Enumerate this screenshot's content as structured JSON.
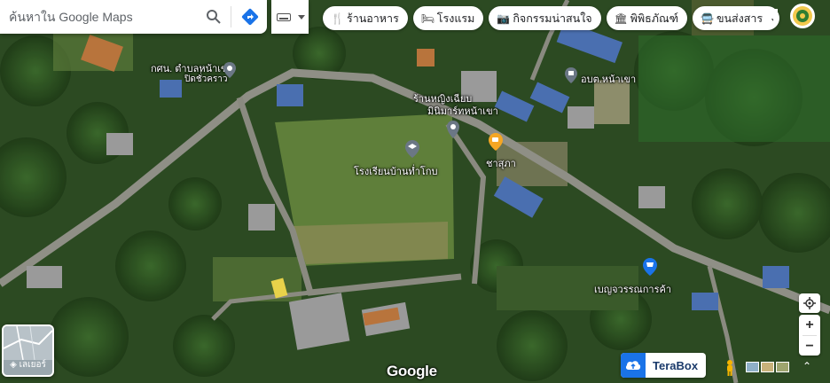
{
  "search": {
    "placeholder": "ค้นหาใน Google Maps"
  },
  "chips": [
    {
      "icon": "fork-knife-icon",
      "glyph": "🍴",
      "label": "ร้านอาหาร"
    },
    {
      "icon": "bed-icon",
      "glyph": "🛏",
      "label": "โรงแรม"
    },
    {
      "icon": "camera-icon",
      "glyph": "📷",
      "label": "กิจกรรมน่าสนใจ"
    },
    {
      "icon": "museum-icon",
      "glyph": "🏛",
      "label": "พิพิธภัณฑ์"
    },
    {
      "icon": "transit-icon",
      "glyph": "🚍",
      "label": "ขนส่งสาร"
    }
  ],
  "places": {
    "health": "กศน. ตำบลหน้าเขา",
    "health_status": "ปิดชั่วคราว",
    "obt": "อบต.หน้าเขา",
    "shop_line1": "ร้านหญิงเฉียบ",
    "shop_line2": "มินิมาร์ทหน้าเขา",
    "cha": "ชาสุภา",
    "school": "โรงเรียนบ้านท่ำโกบ",
    "store": "เบญจวรรณการค้า"
  },
  "layers_label": "เลเยอร์",
  "google_logo": "Google",
  "terabox_label": "TeraBox",
  "colors": {
    "pin_grey": "#6b7785",
    "pin_orange": "#f5a623",
    "pin_blue": "#1a73e8",
    "accent": "#1a73e8"
  }
}
